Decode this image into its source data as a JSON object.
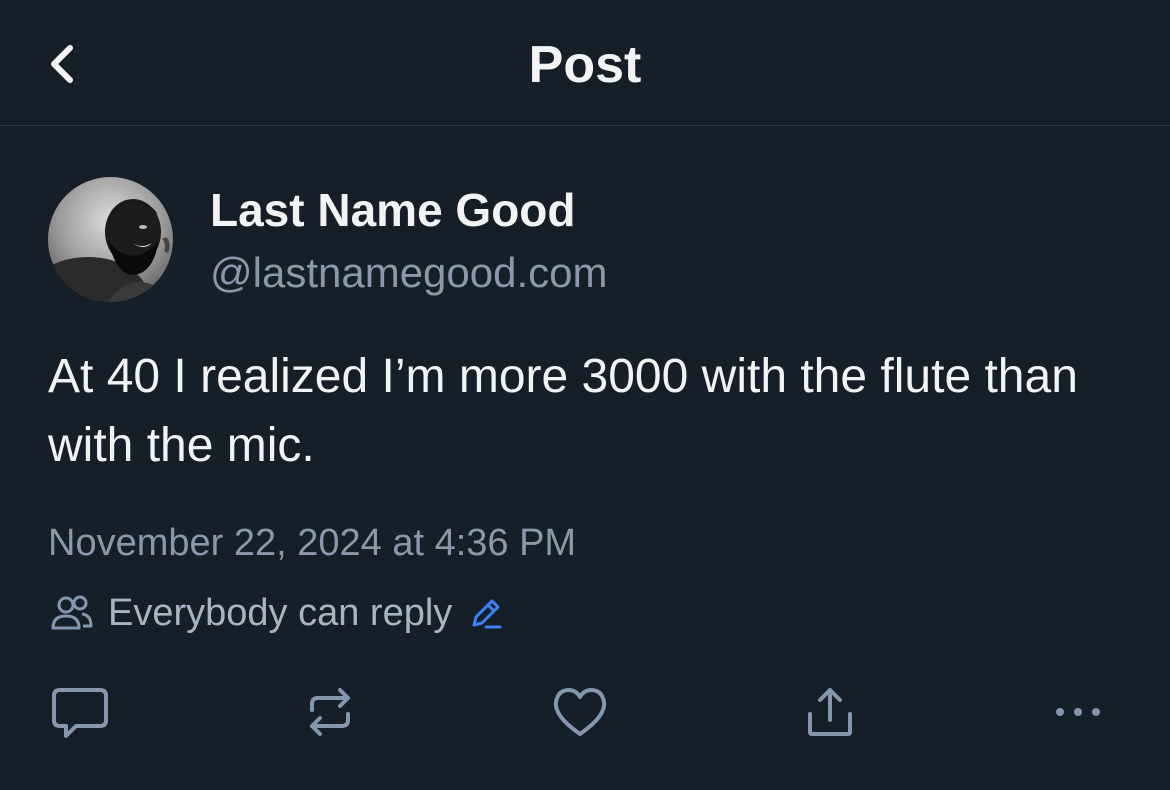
{
  "header": {
    "title": "Post",
    "back_icon": "chevron-left-icon"
  },
  "post": {
    "author": {
      "display_name": "Last Name Good",
      "handle": "@lastnamegood.com"
    },
    "text": "At 40 I realized I’m more 3000 with the flute than with the mic.",
    "timestamp": "November 22, 2024 at 4:36 PM",
    "reply_setting": {
      "label": "Everybody can reply",
      "icon": "people-icon",
      "edit_icon": "pencil-icon"
    }
  },
  "actions": [
    {
      "name": "reply",
      "icon": "comment-icon"
    },
    {
      "name": "repost",
      "icon": "repost-icon"
    },
    {
      "name": "like",
      "icon": "heart-icon"
    },
    {
      "name": "share",
      "icon": "share-icon"
    },
    {
      "name": "more",
      "icon": "more-icon"
    }
  ],
  "colors": {
    "background": "#161e27",
    "text_primary": "#f1f3f5",
    "text_secondary": "#8a98a9",
    "icon": "#8497ad",
    "accent": "#3b82f6",
    "divider": "#2e3a48"
  }
}
